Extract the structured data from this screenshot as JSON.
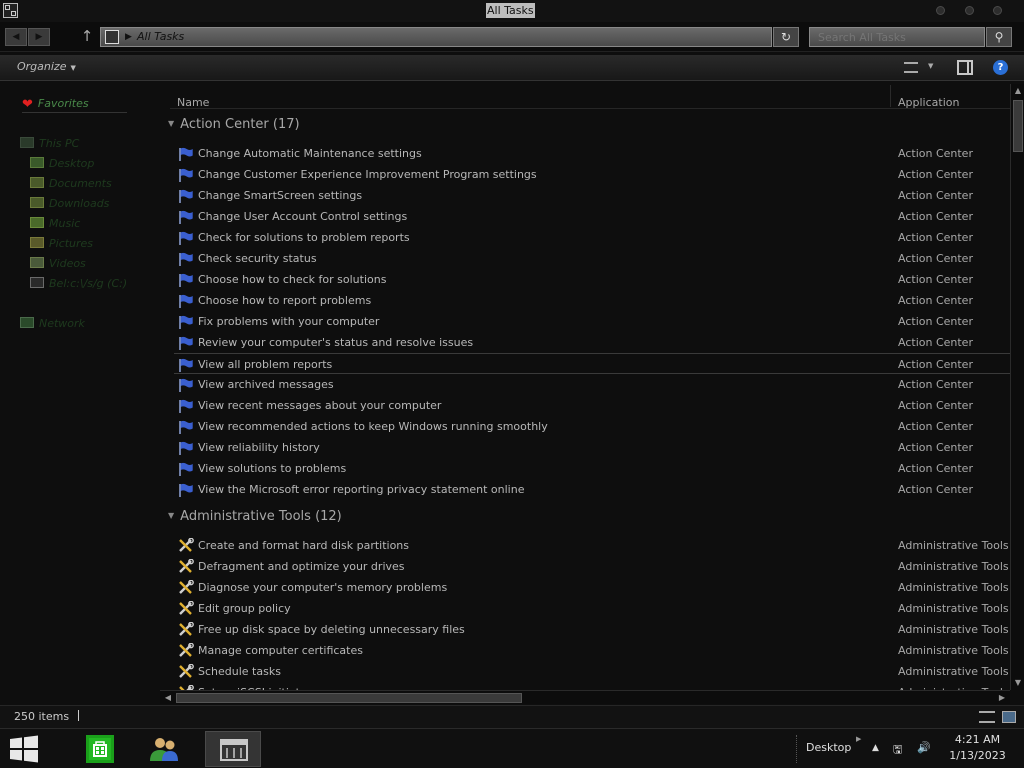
{
  "window": {
    "title": "All Tasks"
  },
  "address": {
    "path": "All Tasks",
    "search_placeholder": "Search All Tasks"
  },
  "command_bar": {
    "organize": "Organize"
  },
  "nav_pane": {
    "favorites": "Favorites",
    "this_pc": "This PC",
    "items": [
      "Desktop",
      "Documents",
      "Downloads",
      "Music",
      "Pictures",
      "Videos",
      "Bel:c:\\/s/g (C:)"
    ],
    "network": "Network"
  },
  "columns": {
    "name": "Name",
    "application": "Application"
  },
  "groups": [
    {
      "label": "Action Center (17)",
      "icon": "flag-icon",
      "items": [
        {
          "name": "Change Automatic Maintenance settings",
          "app": "Action Center"
        },
        {
          "name": "Change Customer Experience Improvement Program settings",
          "app": "Action Center"
        },
        {
          "name": "Change SmartScreen settings",
          "app": "Action Center"
        },
        {
          "name": "Change User Account Control settings",
          "app": "Action Center"
        },
        {
          "name": "Check for solutions to problem reports",
          "app": "Action Center"
        },
        {
          "name": "Check security status",
          "app": "Action Center"
        },
        {
          "name": "Choose how to check for solutions",
          "app": "Action Center"
        },
        {
          "name": "Choose how to report problems",
          "app": "Action Center"
        },
        {
          "name": "Fix problems with your computer",
          "app": "Action Center"
        },
        {
          "name": "Review your computer's status and resolve issues",
          "app": "Action Center"
        },
        {
          "name": "View all problem reports",
          "app": "Action Center",
          "hover": true
        },
        {
          "name": "View archived messages",
          "app": "Action Center"
        },
        {
          "name": "View recent messages about your computer",
          "app": "Action Center"
        },
        {
          "name": "View recommended actions to keep Windows running smoothly",
          "app": "Action Center"
        },
        {
          "name": "View reliability history",
          "app": "Action Center"
        },
        {
          "name": "View solutions to problems",
          "app": "Action Center"
        },
        {
          "name": "View the Microsoft error reporting privacy statement online",
          "app": "Action Center"
        }
      ]
    },
    {
      "label": "Administrative Tools (12)",
      "icon": "tools-icon",
      "items": [
        {
          "name": "Create and format hard disk partitions",
          "app": "Administrative Tools"
        },
        {
          "name": "Defragment and optimize your drives",
          "app": "Administrative Tools"
        },
        {
          "name": "Diagnose your computer's memory problems",
          "app": "Administrative Tools"
        },
        {
          "name": "Edit group policy",
          "app": "Administrative Tools"
        },
        {
          "name": "Free up disk space by deleting unnecessary files",
          "app": "Administrative Tools"
        },
        {
          "name": "Manage computer certificates",
          "app": "Administrative Tools"
        },
        {
          "name": "Schedule tasks",
          "app": "Administrative Tools"
        },
        {
          "name": "Set up iSCSI initiator",
          "app": "Administrative Tools"
        }
      ]
    }
  ],
  "status": {
    "item_count": "250 items"
  },
  "taskbar": {
    "desktop_label": "Desktop",
    "time": "4:21 AM",
    "date": "1/13/2023",
    "pinned": [
      "store-icon",
      "users-icon",
      "file-explorer-icon"
    ]
  },
  "colors": {
    "flag": "#3a5fd0",
    "accent": "#2a6fd6",
    "store_green": "#1aa01a"
  }
}
